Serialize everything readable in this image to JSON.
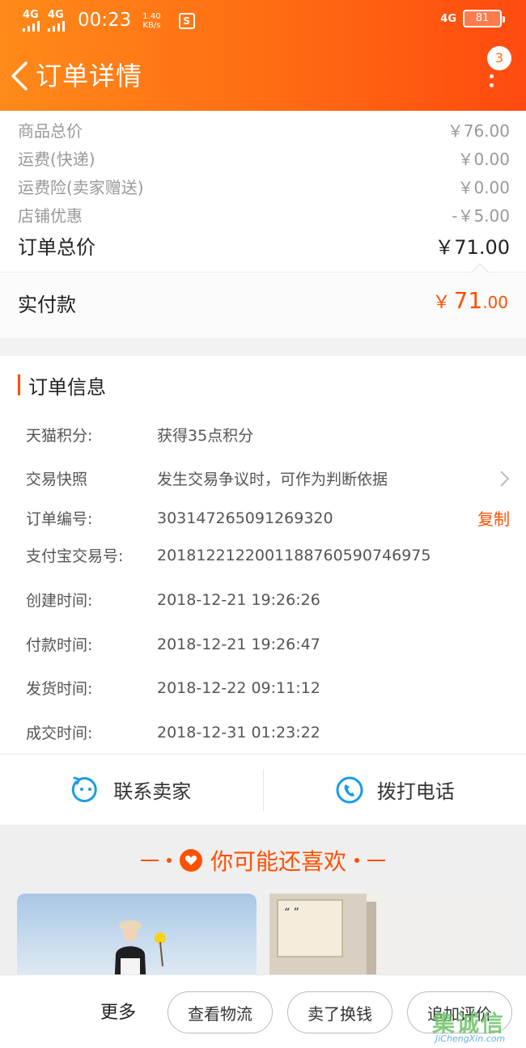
{
  "status_bar": {
    "signal1": "4G",
    "signal2": "4G",
    "time": "00:23",
    "speed_value": "1.40",
    "speed_unit": "KB/s",
    "right_signal": "4G",
    "battery": "81"
  },
  "header": {
    "title": "订单详情",
    "badge_count": "3",
    "accent": "#ff6a12"
  },
  "prices": {
    "rows": [
      {
        "label": "商品总价",
        "value": "￥76.00"
      },
      {
        "label": "运费(快递)",
        "value": "￥0.00"
      },
      {
        "label": "运费险(卖家赠送)",
        "value": "￥0.00"
      },
      {
        "label": "店铺优惠",
        "value": "-￥5.00"
      }
    ],
    "total_label": "订单总价",
    "total_value": "￥71.00",
    "paid_label": "实付款",
    "paid_currency": "￥",
    "paid_int": "71",
    "paid_dec": ".00"
  },
  "order_info": {
    "title": "订单信息",
    "points_key": "天猫积分:",
    "points_val": "获得35点积分",
    "snapshot_key": "交易快照",
    "snapshot_val": "发生交易争议时，可作为判断依据",
    "order_no_key": "订单编号:",
    "order_no_val": "303147265091269320",
    "copy_label": "复制",
    "alipay_key": "支付宝交易号:",
    "alipay_val": "2018122122001188760590746975",
    "created_key": "创建时间:",
    "created_val": "2018-12-21 19:26:26",
    "paid_key": "付款时间:",
    "paid_val": "2018-12-21 19:26:47",
    "shipped_key": "发货时间:",
    "shipped_val": "2018-12-22 09:11:12",
    "done_key": "成交时间:",
    "done_val": "2018-12-31 01:23:22"
  },
  "contact": {
    "seller_label": "联系卖家",
    "phone_label": "拨打电话"
  },
  "recommend": {
    "title": "你可能还喜欢"
  },
  "bottom_bar": {
    "more_label": "更多",
    "logistics_label": "查看物流",
    "resell_label": "卖了换钱",
    "review_label": "追加评价"
  },
  "watermark": {
    "text_cn": "集诚信",
    "text_en": "JiChengXin.com"
  }
}
